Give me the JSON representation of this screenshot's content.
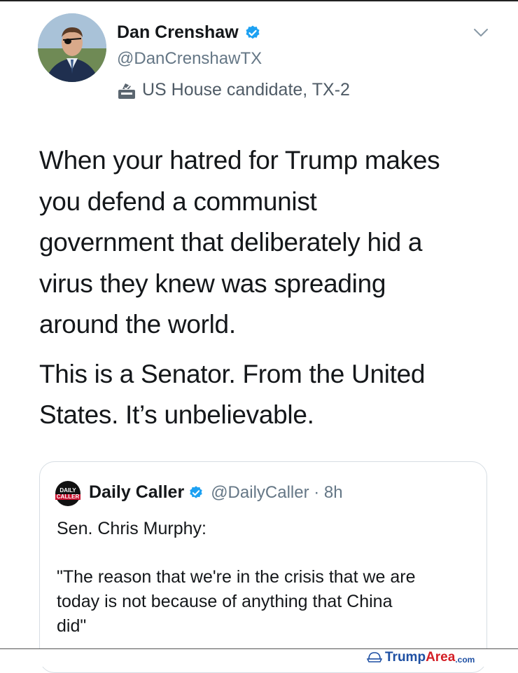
{
  "tweet": {
    "author": {
      "display_name": "Dan Crenshaw",
      "handle": "@DanCrenshawTX",
      "verified": true,
      "label": "US House candidate, TX-2",
      "label_icon": "ballot-box-icon"
    },
    "menu_icon": "chevron-down-icon",
    "paragraphs": [
      "When your hatred for Trump makes\nyou defend a communist\ngovernment that deliberately hid a\nvirus they knew was spreading\naround the world.",
      "This is a Senator. From the United\nStates. It’s unbelievable."
    ],
    "quoted": {
      "display_name": "Daily Caller",
      "handle_time": "@DailyCaller · 8h",
      "logo_text_top": "DAILY",
      "logo_text_bottom": "CALLER",
      "verified": true,
      "paragraphs": [
        "Sen. Chris Murphy:",
        "\"The reason that we're in the crisis that we are\ntoday is not because of anything that China\ndid\""
      ]
    }
  },
  "watermark": {
    "part1": "Trump",
    "part2": "Area",
    "part3": ".com",
    "colors": {
      "blue": "#1d4fa3",
      "red": "#d42027"
    }
  },
  "colors": {
    "verified": "#1da1f2",
    "secondary_text": "#657786"
  }
}
